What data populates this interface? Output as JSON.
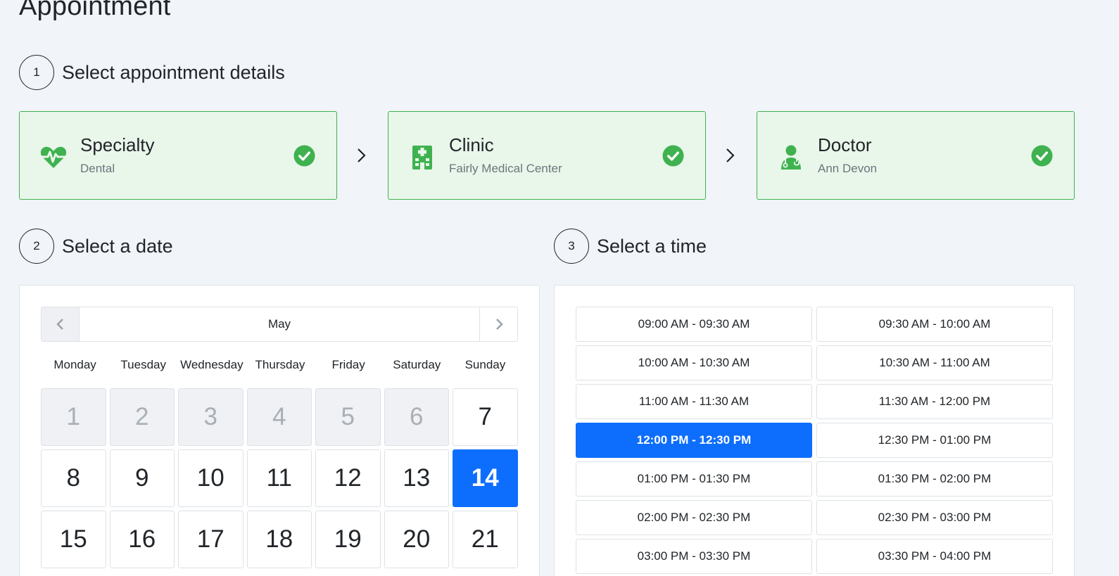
{
  "page": {
    "title": "Appointment"
  },
  "steps": {
    "details": {
      "number": "1",
      "title": "Select appointment details"
    },
    "date": {
      "number": "2",
      "title": "Select a date"
    },
    "time": {
      "number": "3",
      "title": "Select a time"
    }
  },
  "details": [
    {
      "label": "Specialty",
      "value": "Dental",
      "icon": "heartbeat-icon"
    },
    {
      "label": "Clinic",
      "value": "Fairly Medical Center",
      "icon": "hospital-icon"
    },
    {
      "label": "Doctor",
      "value": "Ann Devon",
      "icon": "doctor-icon"
    }
  ],
  "colors": {
    "accent": "#0d6efd",
    "success": "#3fb24f",
    "success_bg": "#e9f6ea"
  },
  "calendar": {
    "month": "May",
    "weekdays": [
      "Monday",
      "Tuesday",
      "Wednesday",
      "Thursday",
      "Friday",
      "Saturday",
      "Sunday"
    ],
    "days": [
      {
        "n": "1",
        "state": "disabled"
      },
      {
        "n": "2",
        "state": "disabled"
      },
      {
        "n": "3",
        "state": "disabled"
      },
      {
        "n": "4",
        "state": "disabled"
      },
      {
        "n": "5",
        "state": "disabled"
      },
      {
        "n": "6",
        "state": "disabled"
      },
      {
        "n": "7",
        "state": "available"
      },
      {
        "n": "8",
        "state": "available"
      },
      {
        "n": "9",
        "state": "available"
      },
      {
        "n": "10",
        "state": "available"
      },
      {
        "n": "11",
        "state": "available"
      },
      {
        "n": "12",
        "state": "available"
      },
      {
        "n": "13",
        "state": "available"
      },
      {
        "n": "14",
        "state": "selected"
      },
      {
        "n": "15",
        "state": "available"
      },
      {
        "n": "16",
        "state": "available"
      },
      {
        "n": "17",
        "state": "available"
      },
      {
        "n": "18",
        "state": "available"
      },
      {
        "n": "19",
        "state": "available"
      },
      {
        "n": "20",
        "state": "available"
      },
      {
        "n": "21",
        "state": "available"
      }
    ]
  },
  "time_slots": [
    {
      "label": "09:00 AM - 09:30 AM",
      "selected": false
    },
    {
      "label": "09:30 AM - 10:00 AM",
      "selected": false
    },
    {
      "label": "10:00 AM - 10:30 AM",
      "selected": false
    },
    {
      "label": "10:30 AM - 11:00 AM",
      "selected": false
    },
    {
      "label": "11:00 AM - 11:30 AM",
      "selected": false
    },
    {
      "label": "11:30 AM - 12:00 PM",
      "selected": false
    },
    {
      "label": "12:00 PM - 12:30 PM",
      "selected": true
    },
    {
      "label": "12:30 PM - 01:00 PM",
      "selected": false
    },
    {
      "label": "01:00 PM - 01:30 PM",
      "selected": false
    },
    {
      "label": "01:30 PM - 02:00 PM",
      "selected": false
    },
    {
      "label": "02:00 PM - 02:30 PM",
      "selected": false
    },
    {
      "label": "02:30 PM - 03:00 PM",
      "selected": false
    },
    {
      "label": "03:00 PM - 03:30 PM",
      "selected": false
    },
    {
      "label": "03:30 PM - 04:00 PM",
      "selected": false
    }
  ]
}
